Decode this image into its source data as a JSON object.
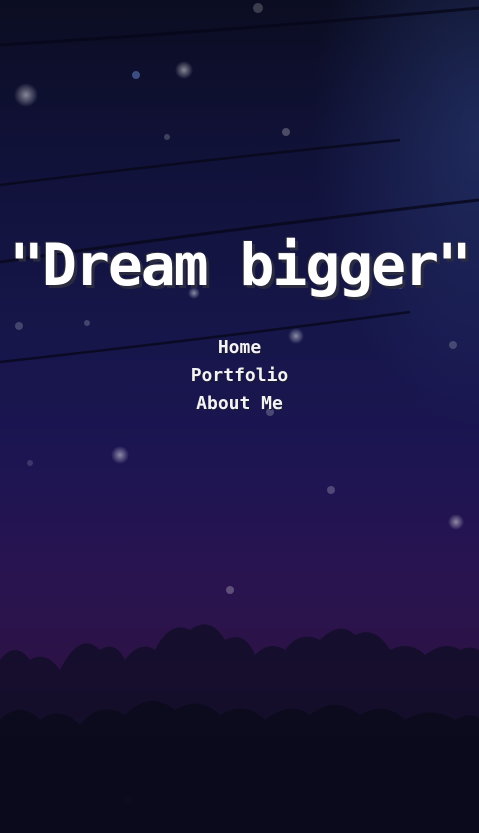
{
  "hero": {
    "quote": "\"Dream bigger\""
  },
  "nav": {
    "items": [
      {
        "label": "Home"
      },
      {
        "label": "Portfolio"
      },
      {
        "label": "About Me"
      }
    ]
  },
  "background": {
    "scene": "night-sky-forest",
    "sky_top_color": "#0b0d22",
    "sky_mid_color": "#16164a",
    "horizon_color": "#2c1244",
    "tree_color": "#0e0c22"
  }
}
